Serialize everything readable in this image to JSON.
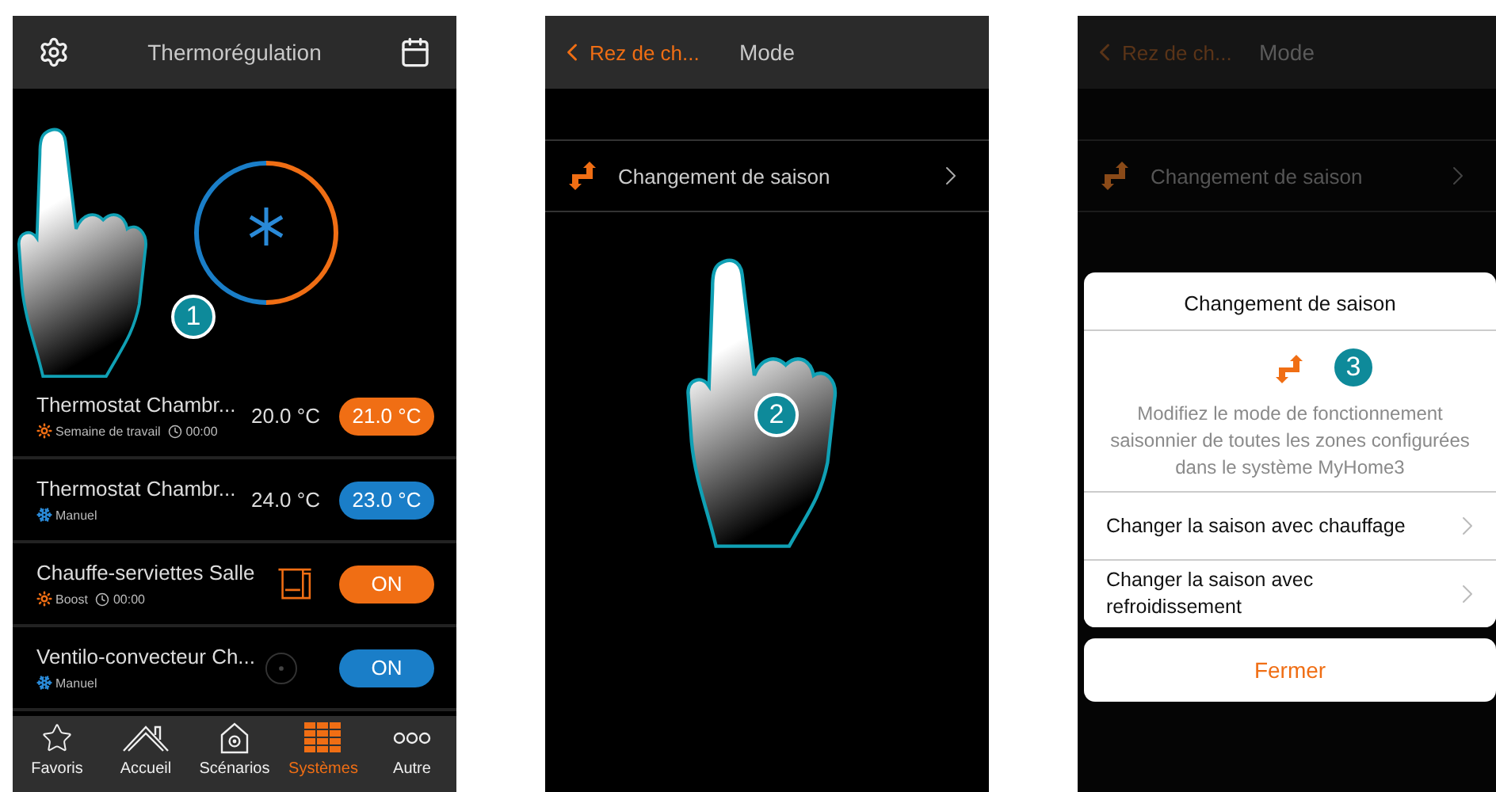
{
  "screens": [
    {
      "kind": "thermoregulation",
      "step": "1",
      "header": {
        "title": "Thermorégulation"
      },
      "devices": [
        {
          "kind": "thermostat",
          "name": "Thermostat Chambr...",
          "mode": {
            "kind": "heat",
            "label": "Semaine de travail"
          },
          "time": "00:00",
          "reading": "20.0 °C",
          "button": "21.0 °C",
          "color": "#f06e14"
        },
        {
          "kind": "thermostat",
          "name": "Thermostat Chambr...",
          "mode": {
            "kind": "cool",
            "label": "Manuel"
          },
          "reading": "24.0 °C",
          "button": "23.0 °C",
          "color": "#1a7ec8"
        },
        {
          "kind": "towel_heater",
          "name": "Chauffe-serviettes Salle",
          "mode": {
            "kind": "heat",
            "label": "Boost"
          },
          "time": "00:00",
          "button": "ON",
          "color": "#f06e14"
        },
        {
          "kind": "fan_coil",
          "name": "Ventilo-convecteur Ch...",
          "mode": {
            "kind": "cool",
            "label": "Manuel"
          },
          "button": "ON",
          "color": "#1a7ec8"
        }
      ],
      "nav": [
        {
          "kind": "star",
          "label": "Favoris",
          "selected": false
        },
        {
          "kind": "home",
          "label": "Accueil",
          "selected": false
        },
        {
          "kind": "scenario",
          "label": "Scénarios",
          "selected": false
        },
        {
          "kind": "grid",
          "label": "Systèmes",
          "selected": true
        },
        {
          "kind": "more",
          "label": "Autre",
          "selected": false
        }
      ]
    },
    {
      "kind": "mode",
      "step": "2",
      "dimmed": false,
      "header": {
        "back": "Rez de ch...",
        "title": "Mode"
      },
      "rows": [
        {
          "label": "Changement de saison"
        }
      ]
    },
    {
      "kind": "mode",
      "step": "3",
      "dimmed": true,
      "header": {
        "back": "Rez de ch...",
        "title": "Mode"
      },
      "rows": [
        {
          "label": "Changement de saison"
        }
      ],
      "dialog": {
        "title": "Changement de saison",
        "description": "Modifiez le mode de fonctionnement saisonnier de toutes les zones configurées dans le système MyHome3",
        "options": [
          {
            "label": "Changer la saison avec chauffage"
          },
          {
            "label": "Changer la saison avec refroidissement"
          }
        ],
        "close": "Fermer"
      }
    }
  ]
}
